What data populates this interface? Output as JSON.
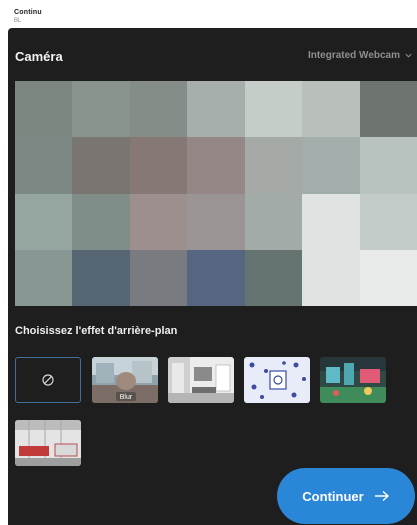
{
  "app": {
    "title": "Continu",
    "subtitle": "BL"
  },
  "camera": {
    "title": "Caméra",
    "device_label": "Integrated Webcam",
    "device_icon": "chevron-down-icon",
    "preview_colors": [
      "#7b8681",
      "#8a948f",
      "#858d89",
      "#a6afab",
      "#c5cdc9",
      "#b9c0bc",
      "#6e7571",
      "#7c8883",
      "#7b7572",
      "#857875",
      "#948785",
      "#a5aaa7",
      "#a2aeab",
      "#b8c3c0",
      "#95a5a0",
      "#7f8e89",
      "#9e8f8f",
      "#9a9594",
      "#a2aba8",
      "#dfe4e2",
      "#c2cbc8",
      "#889694",
      "#566673",
      "#7a7b80",
      "#566582",
      "#657470",
      "#dfe3e1",
      "#e8ebea"
    ]
  },
  "background_effects": {
    "title": "Choisissez l'effet d'arrière-plan",
    "items": [
      {
        "name": "none",
        "icon": "no-effect-icon"
      },
      {
        "name": "blur",
        "label": "Blur"
      },
      {
        "name": "office-room"
      },
      {
        "name": "snowflake-pattern"
      },
      {
        "name": "playful-room"
      },
      {
        "name": "red-interior"
      }
    ]
  },
  "actions": {
    "continue_label": "Continuer",
    "continue_icon": "arrow-right-icon",
    "accent_color": "#2a86d6"
  }
}
